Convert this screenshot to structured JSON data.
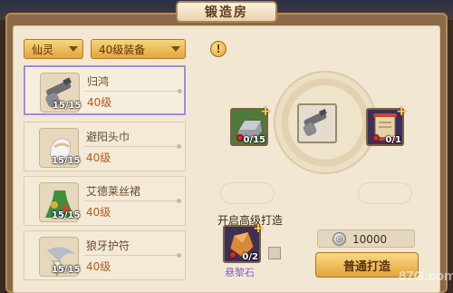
{
  "window": {
    "title": "锻造房"
  },
  "filters": {
    "category": "仙灵",
    "level": "40级装备"
  },
  "info_button": "!",
  "items": [
    {
      "name": "归鸿",
      "level": "40级",
      "count": "15/15",
      "icon": "cannon-icon",
      "selected": true
    },
    {
      "name": "避阳头巾",
      "level": "40级",
      "count": "15/15",
      "icon": "headscarf-icon",
      "selected": false
    },
    {
      "name": "艾德莱丝裙",
      "level": "40级",
      "count": "15/15",
      "icon": "dress-icon",
      "selected": false
    },
    {
      "name": "狼牙护符",
      "level": "40级",
      "count": "15/15",
      "icon": "wolf-fang-icon",
      "selected": false
    }
  ],
  "forge": {
    "material_left": {
      "count": "0/15",
      "icon": "iron-ingot-icon",
      "plus": "+"
    },
    "center": {
      "icon": "cannon-icon"
    },
    "material_right": {
      "count": "0/1",
      "icon": "scroll-icon",
      "plus": "+"
    },
    "advanced": {
      "label": "开启高级打造",
      "stone_name": "悬黎石",
      "stone_count": "0/2",
      "icon": "crystal-icon",
      "plus": "+"
    },
    "cost": "10000",
    "cost_icon": "silver-coin-icon",
    "button_label": "普通打造"
  },
  "watermark": "87G.com",
  "colors": {
    "selected_border": "#9c8ee0",
    "level_text": "#b65a1a",
    "button_gold": "#e2a43e",
    "stone_purple": "#8e5cc6"
  }
}
